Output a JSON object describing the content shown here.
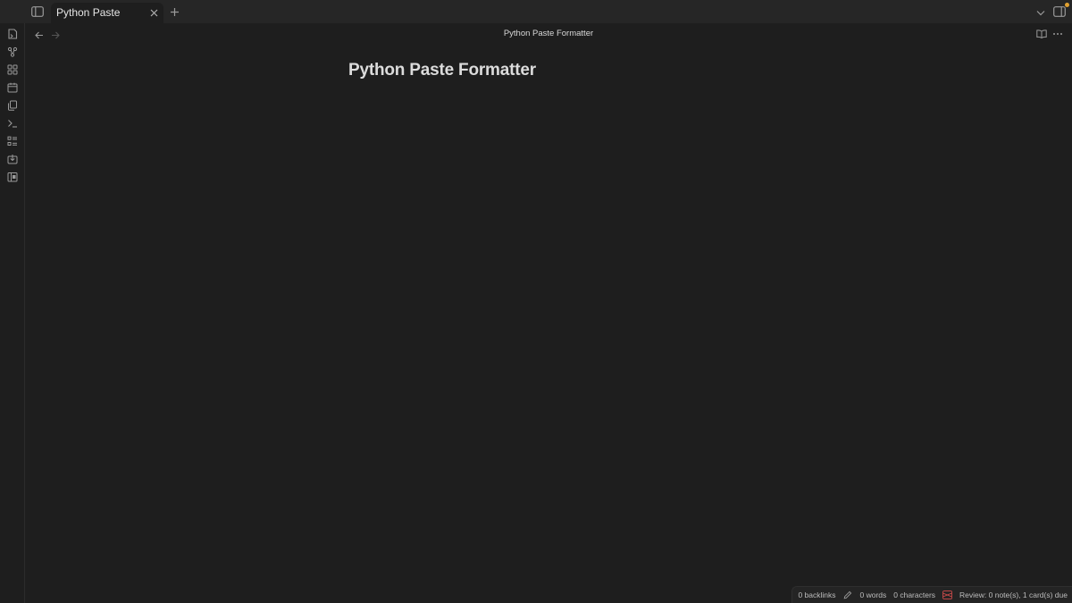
{
  "window": {
    "active_tab_title": "Python Paste Formatter"
  },
  "view": {
    "header_title": "Python Paste Formatter",
    "note_title": "Python Paste Formatter"
  },
  "ribbon": {
    "icons": [
      "switcher-icon",
      "graph-icon",
      "canvas-icon",
      "calendar-icon",
      "templates-icon",
      "terminal-icon",
      "outline-icon",
      "import-icon",
      "flashcards-icon"
    ]
  },
  "statusbar": {
    "backlinks": "0 backlinks",
    "words": "0 words",
    "characters": "0 characters",
    "review": "Review: 0 note(s), 1 card(s) due"
  },
  "colors": {
    "background": "#1e1e1e",
    "titlebar": "#262626",
    "accent_dot": "#e0a030",
    "review_icon": "#d14b4b"
  }
}
